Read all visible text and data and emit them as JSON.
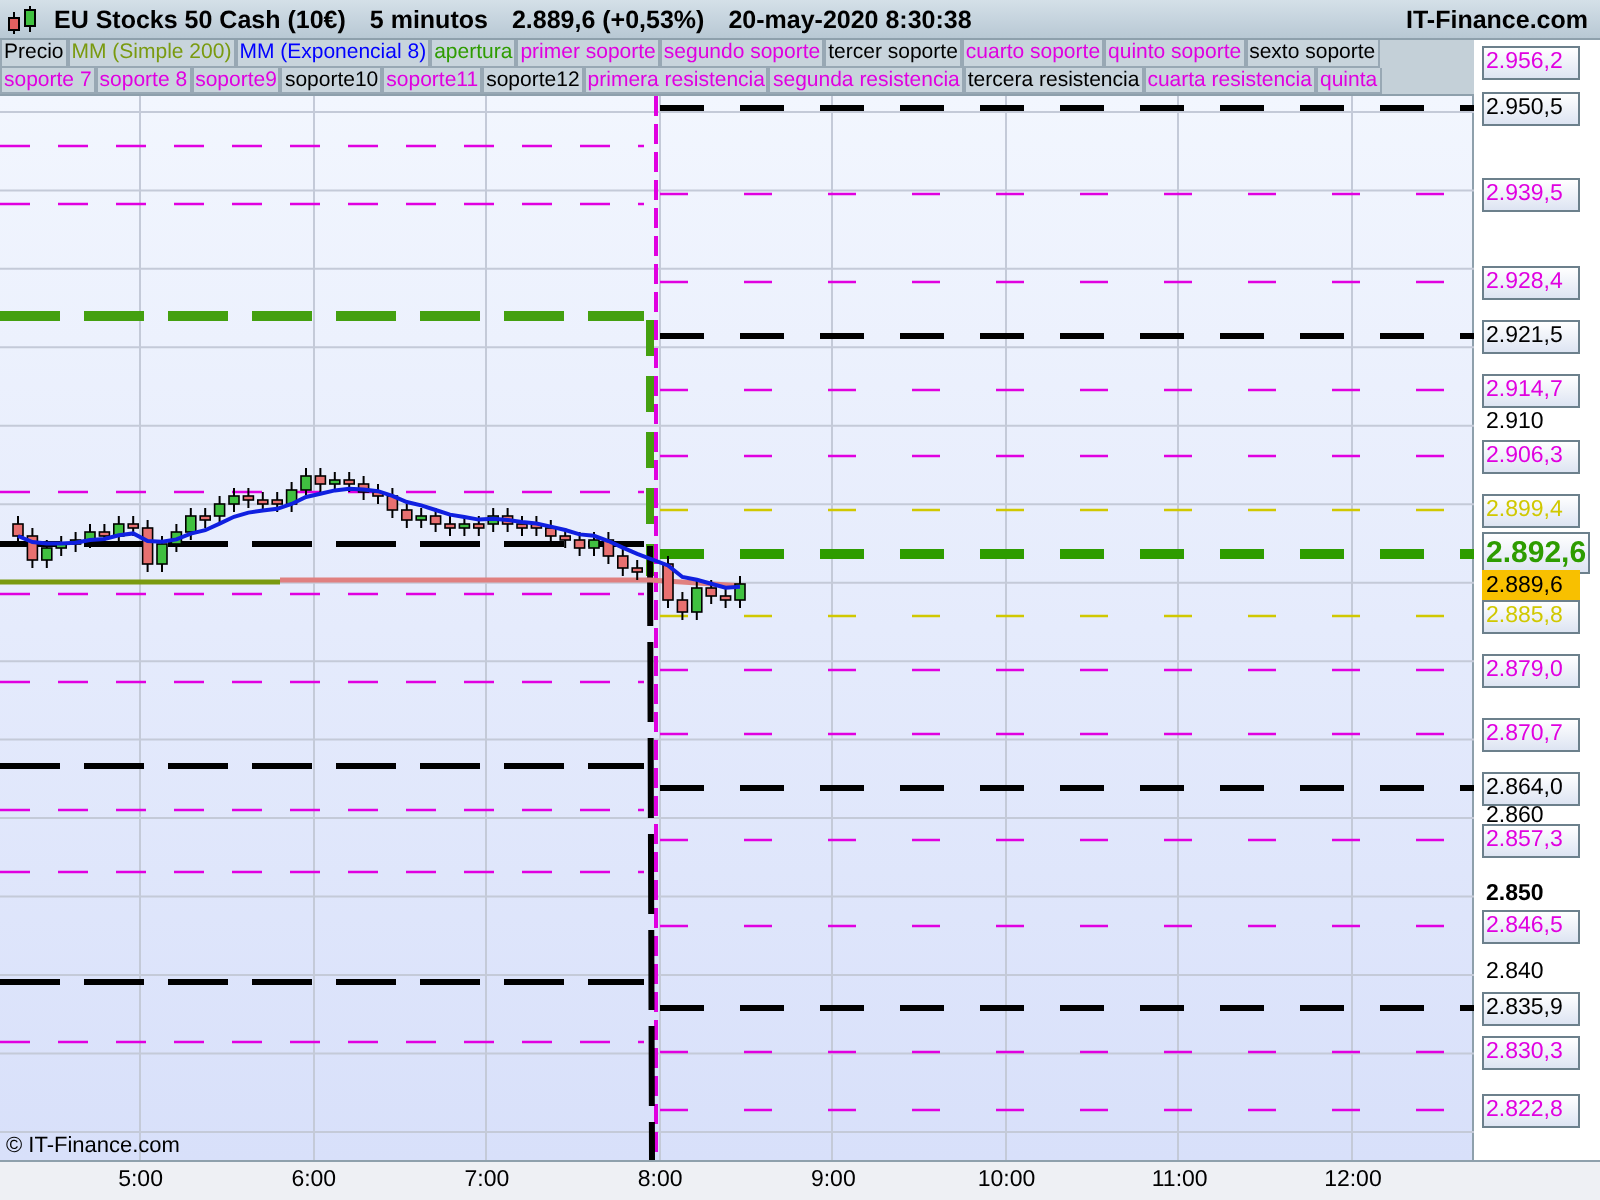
{
  "header": {
    "title": "EU Stocks 50 Cash (10€)",
    "interval": "5 minutos",
    "price": "2.889,6 (+0,53%)",
    "datetime": "20-may-2020 8:30:38",
    "brand": "IT-Finance.com"
  },
  "legend_rows": [
    [
      {
        "label": "Precio",
        "color": "#000000"
      },
      {
        "label": "MM (Simple 200)",
        "color": "#7a9a10"
      },
      {
        "label": "MM (Exponencial 8)",
        "color": "#0000ff"
      },
      {
        "label": "apertura",
        "color": "#2e9c00"
      },
      {
        "label": "primer soporte",
        "color": "#e000e0"
      },
      {
        "label": "segundo soporte",
        "color": "#e000e0"
      },
      {
        "label": "tercer soporte",
        "color": "#000000"
      },
      {
        "label": "cuarto soporte",
        "color": "#e000e0"
      },
      {
        "label": "quinto soporte",
        "color": "#e000e0"
      },
      {
        "label": "sexto soporte",
        "color": "#000000"
      }
    ],
    [
      {
        "label": "soporte 7",
        "color": "#e000e0"
      },
      {
        "label": "soporte 8",
        "color": "#e000e0"
      },
      {
        "label": "soporte9",
        "color": "#e000e0"
      },
      {
        "label": "soporte10",
        "color": "#000000"
      },
      {
        "label": "soporte11",
        "color": "#e000e0"
      },
      {
        "label": "soporte12",
        "color": "#000000"
      },
      {
        "label": "primera resistencia",
        "color": "#e000e0"
      },
      {
        "label": "segunda resistencia",
        "color": "#e000e0"
      },
      {
        "label": "tercera resistencia",
        "color": "#000000"
      },
      {
        "label": "cuarta resistencia",
        "color": "#e000e0"
      },
      {
        "label": "quinta",
        "color": "#e000e0"
      }
    ]
  ],
  "price_axis": [
    {
      "text": "2.956,2",
      "kind": "boxed",
      "color": "#e000e0"
    },
    {
      "text": "2.950,5",
      "kind": "boxed",
      "color": "#000000"
    },
    {
      "text": "2.939,5",
      "kind": "boxed",
      "color": "#e000e0"
    },
    {
      "text": "2.928,4",
      "kind": "boxed",
      "color": "#e000e0"
    },
    {
      "text": "2.921,5",
      "kind": "boxed",
      "color": "#000000"
    },
    {
      "text": "2.914,7",
      "kind": "boxed",
      "color": "#e000e0"
    },
    {
      "text": "2.910",
      "kind": "tick"
    },
    {
      "text": "2.906,3",
      "kind": "boxed",
      "color": "#e000e0"
    },
    {
      "text": "2.899,4",
      "kind": "boxed",
      "color": "#d0c800"
    },
    {
      "text": "2.892,6",
      "kind": "current",
      "color": "#2e9c00"
    },
    {
      "text": "2.889,6",
      "kind": "last"
    },
    {
      "text": "2.885,8",
      "kind": "boxed",
      "color": "#d0c800"
    },
    {
      "text": "2.879,0",
      "kind": "boxed",
      "color": "#e000e0"
    },
    {
      "text": "2.870,7",
      "kind": "boxed",
      "color": "#e000e0"
    },
    {
      "text": "2.864,0",
      "kind": "boxed",
      "color": "#000000"
    },
    {
      "text": "2.860",
      "kind": "tick"
    },
    {
      "text": "2.857,3",
      "kind": "boxed",
      "color": "#e000e0"
    },
    {
      "text": "2.850",
      "kind": "major_tick"
    },
    {
      "text": "2.846,5",
      "kind": "boxed",
      "color": "#e000e0"
    },
    {
      "text": "2.840",
      "kind": "tick"
    },
    {
      "text": "2.835,9",
      "kind": "boxed",
      "color": "#000000"
    },
    {
      "text": "2.830,3",
      "kind": "boxed",
      "color": "#e000e0"
    },
    {
      "text": "2.822,8",
      "kind": "boxed",
      "color": "#e000e0"
    }
  ],
  "time_axis": [
    "5:00",
    "6:00",
    "7:00",
    "8:00",
    "9:00",
    "10:00",
    "11:00",
    "12:00"
  ],
  "copyright": "© IT-Finance.com"
}
